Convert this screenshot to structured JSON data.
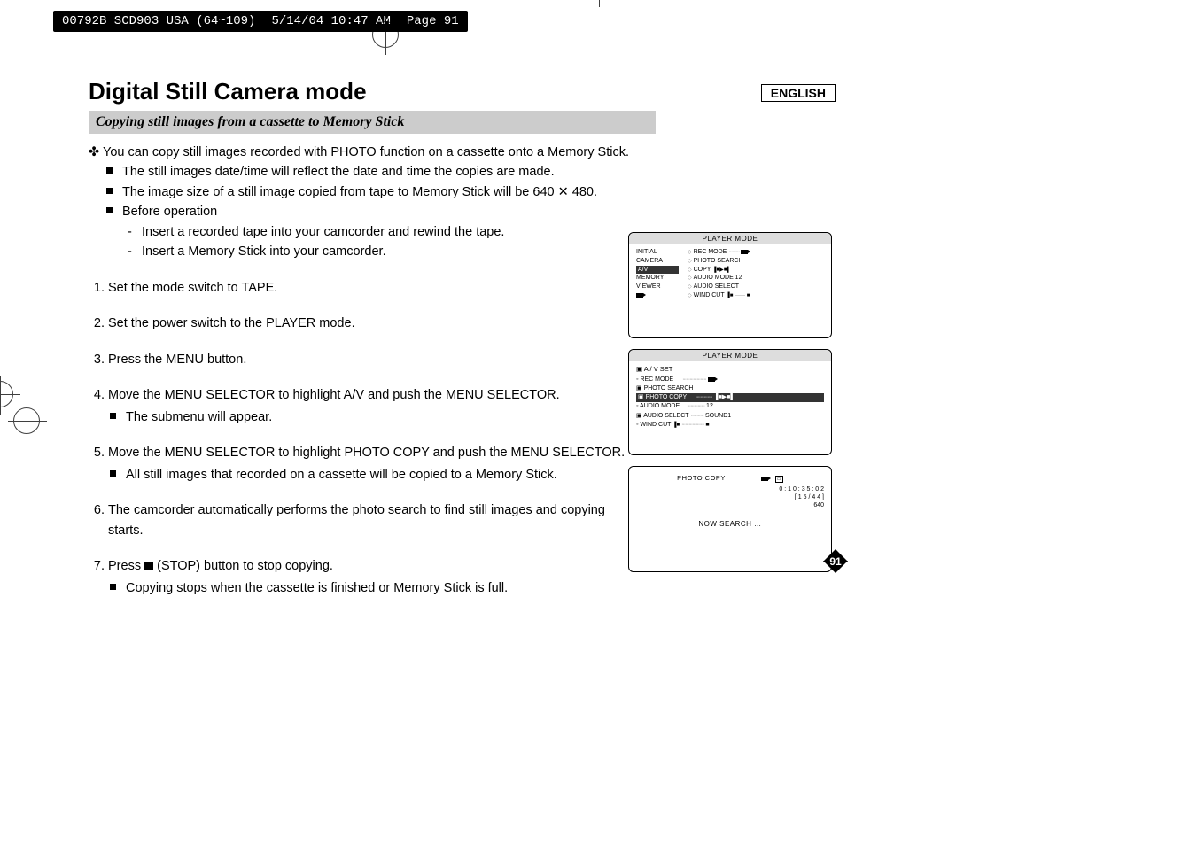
{
  "header": {
    "doc_id": "00792B SCD903 USA (64~109)",
    "date_time": "5/14/04 10:47 AM",
    "page_marker": "Page 91"
  },
  "lang_badge": "ENGLISH",
  "title": "Digital Still Camera mode",
  "subtitle": "Copying still images from a cassette to Memory Stick",
  "intro": {
    "line1": "You can copy still images recorded with PHOTO function on a cassette onto a Memory Stick.",
    "sq1": "The still images date/time will reflect the date and time the copies are made.",
    "sq2": "The image size of a still image copied from tape to Memory Stick will be 640 ✕ 480.",
    "sq3": "Before operation",
    "dash1": "Insert a recorded tape into your camcorder and rewind the tape.",
    "dash2": "Insert a Memory Stick into your camcorder."
  },
  "steps": {
    "s1": "Set the mode switch to TAPE.",
    "s2": "Set the power switch to the PLAYER mode.",
    "s3": "Press the MENU button.",
    "s4": "Move the MENU SELECTOR to highlight A/V and push the MENU SELECTOR.",
    "s4_sub": "The submenu will appear.",
    "s5": "Move the MENU SELECTOR to highlight PHOTO COPY and push the MENU SELECTOR.",
    "s5_sub": "All still images that recorded on a cassette will be copied to a Memory Stick.",
    "s6": "The camcorder automatically performs the photo search to find still images and copying starts.",
    "s7_pre": "Press ",
    "s7_post": " (STOP) button to stop copying.",
    "s7_sub": "Copying stops when the cassette is finished or Memory Stick is full."
  },
  "screen1": {
    "title": "PLAYER  MODE",
    "left": {
      "l1": "INITIAL",
      "l2": "CAMERA",
      "l3": "A/V",
      "l4": "MEMORY",
      "l5": "VIEWER"
    },
    "right": {
      "r1": "REC MODE",
      "r2": "PHOTO SEARCH",
      "r3": "COPY",
      "r4": "AUDIO MODE     12",
      "r5": "AUDIO SELECT",
      "r6": "WIND CUT"
    }
  },
  "screen2": {
    "title": "PLAYER  MODE",
    "heading": "A / V  SET",
    "rows": {
      "r1": "REC MODE",
      "r2": "PHOTO SEARCH",
      "r3": "PHOTO COPY",
      "r4": "AUDIO MODE",
      "r4v": "12",
      "r5": "AUDIO SELECT",
      "r5v": "SOUND1",
      "r6": "WIND CUT"
    }
  },
  "screen3": {
    "label": "PHOTO COPY",
    "time": "0 : 1 0 : 3 5 : 0 2",
    "counter": "[ 1 5 / 4 4 ]",
    "size": "640",
    "status": "NOW SEARCH …"
  },
  "page_number": "91"
}
